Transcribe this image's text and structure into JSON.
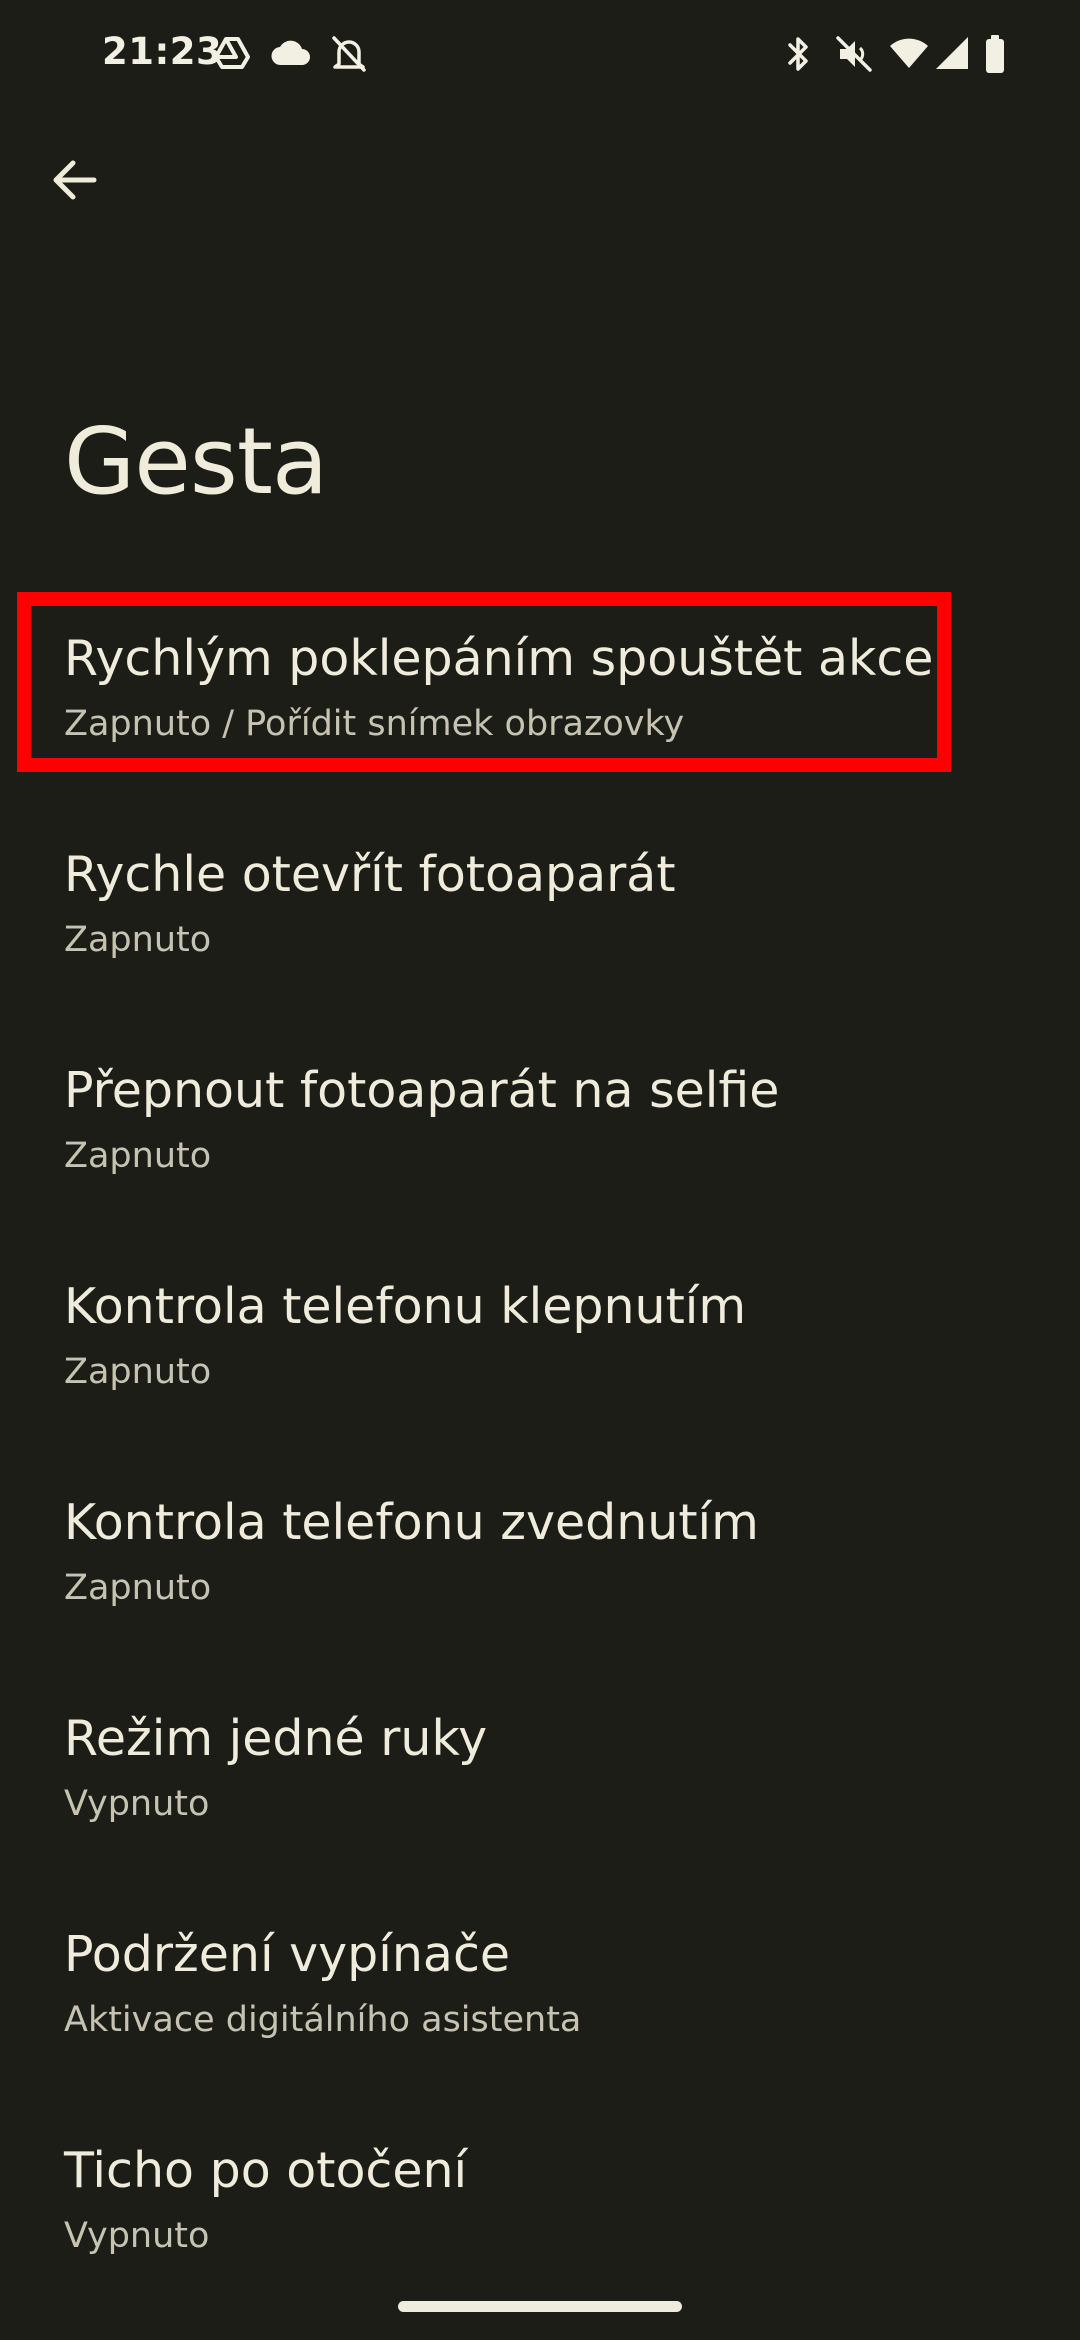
{
  "status_bar": {
    "time": "21:23",
    "left_icons": [
      "drive-icon",
      "cloud-icon",
      "notifications-off-icon"
    ],
    "right_icons": [
      "bluetooth-icon",
      "mute-icon",
      "wifi-icon",
      "signal-icon",
      "battery-icon"
    ]
  },
  "header": {
    "back_icon": "arrow-back-icon",
    "title": "Gesta"
  },
  "settings": {
    "items": [
      {
        "title": "Rychlým poklepáním spouštět akce",
        "summary": "Zapnuto / Pořídit snímek obrazovky",
        "highlighted": true
      },
      {
        "title": "Rychle otevřít fotoaparát",
        "summary": "Zapnuto"
      },
      {
        "title": "Přepnout fotoaparát na selfie",
        "summary": "Zapnuto"
      },
      {
        "title": "Kontrola telefonu klepnutím",
        "summary": "Zapnuto"
      },
      {
        "title": "Kontrola telefonu zvednutím",
        "summary": "Zapnuto"
      },
      {
        "title": "Režim jedné ruky",
        "summary": "Vypnuto"
      },
      {
        "title": "Podržení vypínače",
        "summary": "Aktivace digitálního asistenta"
      },
      {
        "title": "Ticho po otočení",
        "summary": "Vypnuto"
      }
    ]
  },
  "colors": {
    "background": "#1d1d17",
    "highlight": "#ff0000"
  }
}
